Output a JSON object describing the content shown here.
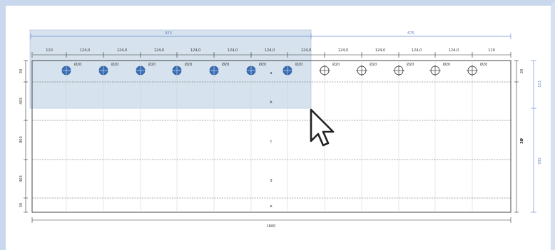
{
  "drawing": {
    "top_blue_dims": [
      "923",
      "675"
    ],
    "top_segments": [
      "110",
      "124,0",
      "124,0",
      "124,0",
      "124,0",
      "124,0",
      "124,0",
      "124,0",
      "124,0",
      "124,0",
      "124,0",
      "124,0",
      "110"
    ],
    "hole_labels": [
      "Ø20",
      "Ø20",
      "Ø20",
      "Ø20",
      "Ø20",
      "Ø20",
      "Ø20",
      "Ø20",
      "Ø20",
      "Ø20",
      "Ø20",
      "Ø20"
    ],
    "left_dims": [
      "30",
      "403",
      "903",
      "403",
      "30"
    ],
    "row_labels": [
      "a",
      "b",
      "c",
      "d",
      "e"
    ],
    "right_dims": [
      "30",
      "3Ø"
    ],
    "right_blue_dims": [
      "113",
      "935"
    ],
    "bottom_dim": "1600",
    "colors": {
      "selection_fill": "#b4cade",
      "blue_hole": "#3a6fb6",
      "dim_blue": "#6d8fd3"
    }
  }
}
